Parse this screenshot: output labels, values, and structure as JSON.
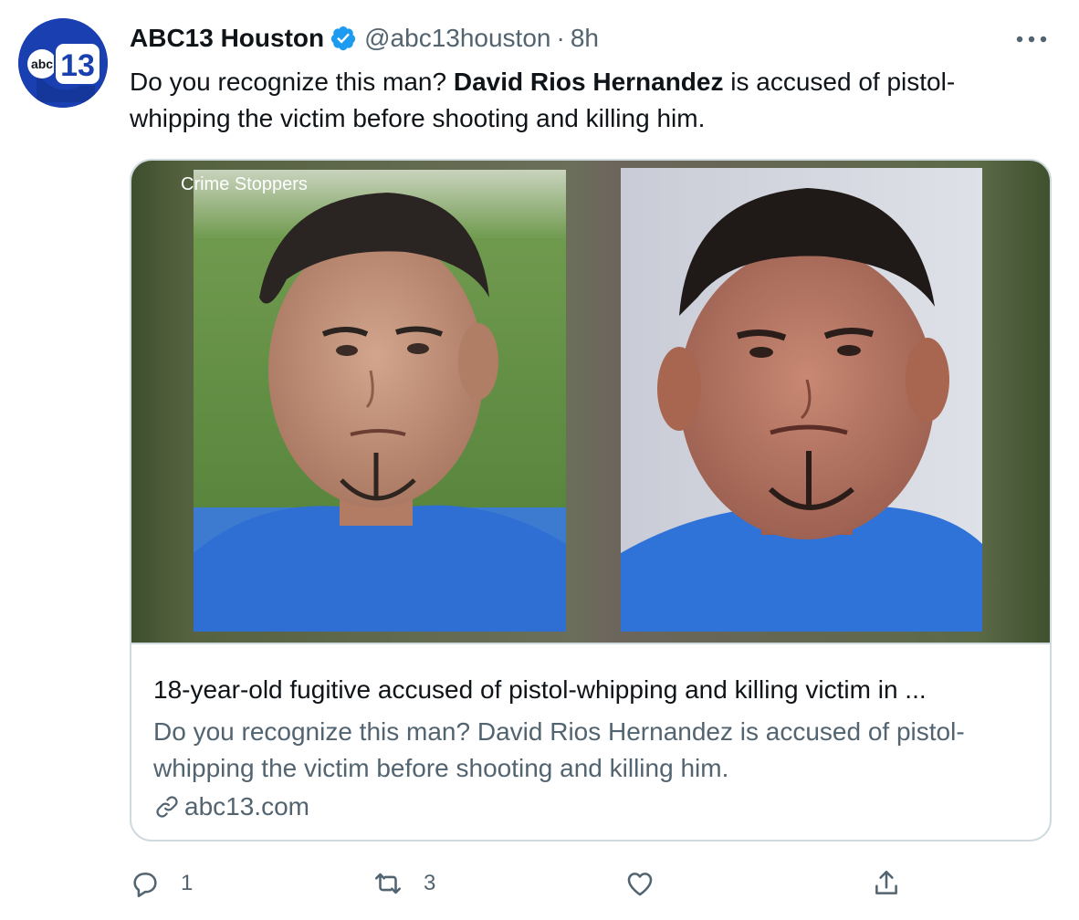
{
  "author": {
    "display_name": "ABC13 Houston",
    "handle": "@abc13houston",
    "separator": "·",
    "time": "8h",
    "avatar_text_abc": "abc",
    "avatar_text_13": "13"
  },
  "tweet": {
    "text_before": "Do you recognize this man? ",
    "text_bold": "David Rios Hernandez",
    "text_after": " is accused of pistol-whipping the victim before shooting and killing him."
  },
  "card": {
    "media_watermark": "Crime Stoppers",
    "title": "18-year-old fugitive accused of pistol-whipping and killing victim in ...",
    "description": "Do you recognize this man? David Rios Hernandez is accused of pistol-whipping the victim before shooting and killing him.",
    "domain": "abc13.com"
  },
  "actions": {
    "reply_count": "1",
    "retweet_count": "3",
    "like_count": "",
    "share_count": ""
  },
  "colors": {
    "text_primary": "#0f1419",
    "text_secondary": "#536471",
    "verified": "#1d9bf0",
    "border": "#cfd9de",
    "abc_blue": "#1a3fb0"
  },
  "icons": {
    "more": "more-dots-icon",
    "verified": "verified-badge-icon",
    "link": "link-icon",
    "reply": "reply-icon",
    "retweet": "retweet-icon",
    "like": "heart-icon",
    "share": "share-icon"
  }
}
